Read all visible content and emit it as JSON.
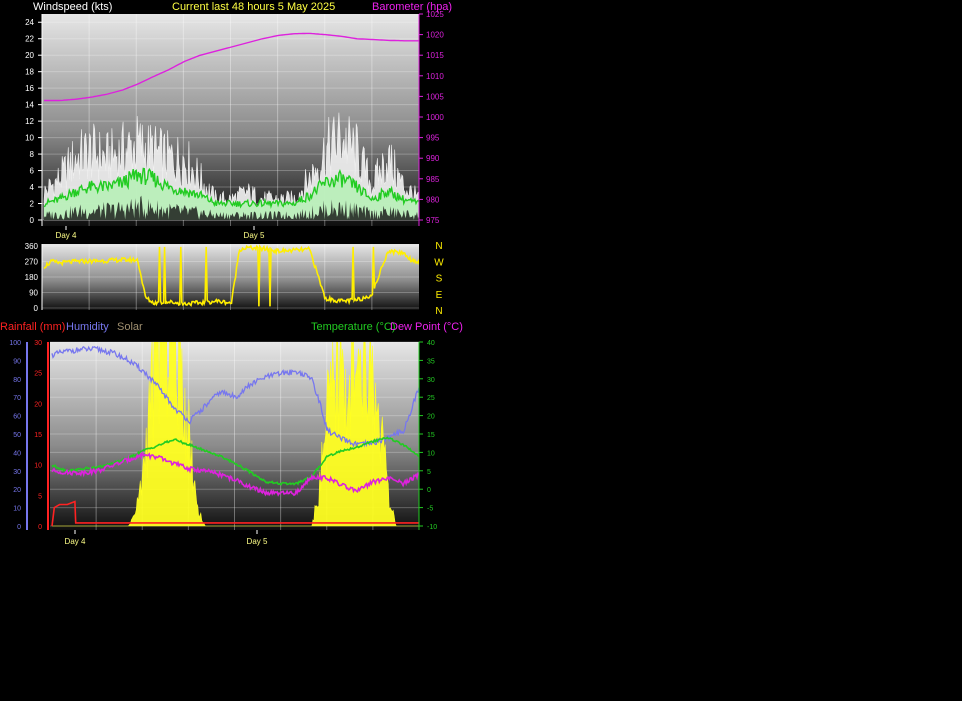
{
  "header": {
    "left": "Windspeed (kts)",
    "center": "Current last 48 hours 5 May 2025",
    "right": "Barometer (hpa)"
  },
  "colors": {
    "wind_gust": "#f0f0f0",
    "wind_avg": "#22cc22",
    "wind_low": "#b8f0b8",
    "barometer": "#dd22dd",
    "direction": "#ffee00",
    "rainfall": "#ff2222",
    "humidity": "#7777ee",
    "solar": "#ffff22",
    "temperature": "#22cc22",
    "dewpoint": "#dd22dd",
    "day_labels": "#ffff88"
  },
  "chart_data": [
    {
      "type": "area",
      "title": "Windspeed (kts)",
      "y_ticks": [
        0,
        2,
        4,
        6,
        8,
        10,
        12,
        14,
        16,
        18,
        20,
        22,
        24
      ],
      "ylim": [
        0,
        25
      ],
      "y2_label": "Barometer (hpa)",
      "y2_ticks": [
        975,
        980,
        985,
        990,
        995,
        1000,
        1005,
        1010,
        1015,
        1020,
        1025
      ],
      "y2lim": [
        975,
        1025
      ],
      "x_labels": [
        "Day 4",
        "Day 5"
      ],
      "series": [
        {
          "kind": "barometer",
          "x": [
            0,
            1,
            2,
            4,
            6,
            8,
            10,
            12,
            14,
            16,
            18,
            20,
            22,
            24,
            26,
            28,
            30,
            32,
            34,
            36,
            38,
            40,
            42,
            44,
            46,
            48
          ],
          "values": [
            1004,
            1004,
            1004,
            1004.3,
            1004.8,
            1005.5,
            1006.5,
            1008,
            1009.8,
            1011.5,
            1013.5,
            1015,
            1016,
            1017,
            1018,
            1019,
            1019.8,
            1020.2,
            1020.3,
            1020,
            1019.6,
            1019,
            1018.8,
            1018.6,
            1018.5,
            1018.5
          ]
        },
        {
          "kind": "wind_gust",
          "x": [
            0,
            2,
            4,
            6,
            8,
            10,
            12,
            14,
            16,
            18,
            20,
            22,
            24,
            26,
            28,
            30,
            32,
            34,
            36,
            38,
            40,
            42,
            44,
            46,
            48
          ],
          "values": [
            4,
            6,
            9,
            10,
            9,
            10,
            11,
            10,
            9,
            9,
            6,
            3,
            3,
            4,
            3,
            3,
            3,
            6,
            10,
            12,
            10,
            5,
            9,
            5,
            3
          ]
        },
        {
          "kind": "wind_avg",
          "x": [
            0,
            2,
            4,
            6,
            8,
            10,
            12,
            14,
            16,
            18,
            20,
            22,
            24,
            26,
            28,
            30,
            32,
            34,
            36,
            38,
            40,
            42,
            44,
            46,
            48
          ],
          "values": [
            2,
            2.5,
            3.5,
            4,
            4,
            4.5,
            5.5,
            5,
            4,
            3.5,
            3,
            2,
            2,
            2,
            2,
            2,
            2,
            3,
            4.5,
            5,
            4,
            2.5,
            3.5,
            2.5,
            2
          ]
        }
      ]
    },
    {
      "type": "line",
      "title": "Wind direction",
      "y_ticks": [
        0,
        90,
        180,
        270,
        360
      ],
      "ylim": [
        0,
        360
      ],
      "compass": [
        "N",
        "W",
        "S",
        "E",
        "N"
      ],
      "x": [
        0,
        0.5,
        1,
        2,
        4,
        6,
        8,
        10,
        12,
        13,
        14,
        16,
        18,
        20,
        22,
        24,
        25,
        26,
        28,
        30,
        32,
        34,
        36,
        38,
        40,
        41,
        42,
        44,
        46,
        47,
        48
      ],
      "values": [
        240,
        255,
        270,
        262,
        270,
        272,
        275,
        280,
        278,
        60,
        30,
        35,
        25,
        30,
        40,
        30,
        340,
        350,
        345,
        330,
        335,
        340,
        55,
        40,
        45,
        60,
        80,
        330,
        320,
        280,
        270
      ]
    },
    {
      "type": "line",
      "title": "Rainfall / Humidity / Solar / Temperature / Dew Point",
      "legend_left": [
        "Rainfall (mm)",
        "Humidity",
        "Solar"
      ],
      "legend_right": [
        "Temperature (°C)",
        "Dew Point (°C)"
      ],
      "humidity_ticks": [
        0,
        10,
        20,
        30,
        40,
        50,
        60,
        70,
        80,
        90,
        100
      ],
      "rain_ticks": [
        0,
        5,
        10,
        15,
        20,
        25,
        30
      ],
      "temp_ticks": [
        -10,
        -5,
        0,
        5,
        10,
        15,
        20,
        25,
        30,
        35,
        40
      ],
      "humidity_lim": [
        0,
        100
      ],
      "rain_lim": [
        0,
        30
      ],
      "temp_lim": [
        -10,
        40
      ],
      "x_labels": [
        "Day 4",
        "Day 5"
      ],
      "series": [
        {
          "name": "Humidity",
          "x": [
            0,
            2,
            4,
            6,
            8,
            10,
            12,
            14,
            16,
            18,
            20,
            22,
            24,
            26,
            28,
            30,
            32,
            34,
            35,
            36,
            38,
            40,
            42,
            44,
            46,
            47,
            48
          ],
          "values": [
            93,
            95,
            96,
            96,
            94,
            90,
            84,
            75,
            64,
            57,
            65,
            73,
            70,
            77,
            81,
            83,
            84,
            80,
            67,
            52,
            47,
            44,
            45,
            48,
            52,
            63,
            76
          ]
        },
        {
          "name": "Temperature (°C)",
          "x": [
            0,
            2,
            4,
            6,
            8,
            10,
            12,
            14,
            16,
            18,
            20,
            22,
            24,
            26,
            28,
            30,
            32,
            34,
            36,
            38,
            40,
            42,
            44,
            46,
            48
          ],
          "values": [
            6.5,
            5,
            5.5,
            6,
            7,
            8.5,
            10.5,
            12,
            13.5,
            12,
            10.5,
            9,
            7,
            4.5,
            2,
            1.5,
            1.5,
            3.5,
            9,
            10.5,
            11.5,
            13,
            14,
            12,
            9
          ]
        },
        {
          "name": "Dew Point (°C)",
          "x": [
            0,
            2,
            4,
            6,
            8,
            10,
            12,
            14,
            16,
            18,
            20,
            22,
            24,
            26,
            28,
            30,
            32,
            34,
            36,
            38,
            40,
            42,
            44,
            46,
            48
          ],
          "values": [
            5,
            4.5,
            4.5,
            5,
            6.5,
            8,
            9.5,
            8.5,
            7,
            5.5,
            5,
            4,
            2.5,
            0.5,
            -1,
            -1.2,
            -1,
            3.5,
            3,
            1,
            -0.5,
            2,
            3,
            1.5,
            4
          ]
        },
        {
          "name": "Rainfall (mm)",
          "x": [
            0,
            0.3,
            1,
            2,
            3,
            3.1,
            4,
            48
          ],
          "values": [
            0,
            3,
            3.5,
            3.5,
            4,
            0.5,
            0.5,
            0.5
          ]
        },
        {
          "name": "Solar",
          "x": [
            0,
            10,
            11,
            12,
            13,
            14,
            15,
            16,
            17,
            18,
            19,
            20,
            34,
            35,
            36,
            37,
            38,
            39,
            40,
            41,
            42,
            43,
            44,
            45,
            48
          ],
          "values": [
            0,
            0,
            3,
            12,
            28,
            38,
            42,
            40,
            32,
            18,
            4,
            0,
            0,
            8,
            22,
            30,
            31,
            30,
            28,
            31,
            30,
            20,
            6,
            0,
            0
          ]
        }
      ]
    }
  ]
}
